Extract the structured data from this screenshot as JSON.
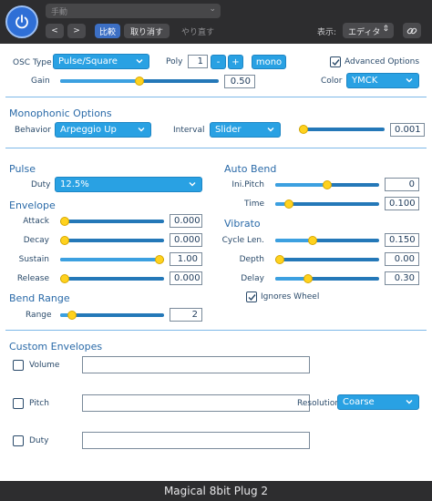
{
  "host": {
    "preset_name": "手動",
    "prev_label": "<",
    "next_label": ">",
    "compare_label": "比較",
    "undo_label": "取り消す",
    "redo_label": "やり直す",
    "view_label": "表示:",
    "view_value": "エディタ"
  },
  "osc": {
    "type_label": "OSC Type",
    "type_value": "Pulse/Square",
    "poly_label": "Poly",
    "poly_value": "1",
    "minus_label": "-",
    "plus_label": "+",
    "mono_label": "mono",
    "advanced_label": "Advanced Options",
    "advanced_checked": true,
    "gain_label": "Gain",
    "gain_value": "0.50",
    "gain_fraction": 0.5,
    "color_label": "Color",
    "color_value": "YMCK"
  },
  "mono": {
    "title": "Monophonic Options",
    "behavior_label": "Behavior",
    "behavior_value": "Arpeggio Up",
    "interval_label": "Interval",
    "interval_value": "Slider",
    "interval_num": "0.001",
    "interval_fraction": 0.0
  },
  "pulse": {
    "title": "Pulse",
    "duty_label": "Duty",
    "duty_value": "12.5%"
  },
  "envelope": {
    "title": "Envelope",
    "rows": [
      {
        "label": "Attack",
        "value": "0.000",
        "fraction": 0.0
      },
      {
        "label": "Decay",
        "value": "0.000",
        "fraction": 0.0
      },
      {
        "label": "Sustain",
        "value": "1.00",
        "fraction": 1.0
      },
      {
        "label": "Release",
        "value": "0.000",
        "fraction": 0.0
      }
    ]
  },
  "bend_range": {
    "title": "Bend Range",
    "range_label": "Range",
    "range_value": "2",
    "range_fraction": 0.08
  },
  "auto_bend": {
    "title": "Auto Bend",
    "rows": [
      {
        "label": "Ini.Pitch",
        "value": "0",
        "fraction": 0.5
      },
      {
        "label": "Time",
        "value": "0.100",
        "fraction": 0.1
      }
    ]
  },
  "vibrato": {
    "title": "Vibrato",
    "rows": [
      {
        "label": "Cycle Len.",
        "value": "0.150",
        "fraction": 0.35
      },
      {
        "label": "Depth",
        "value": "0.00",
        "fraction": 0.0
      },
      {
        "label": "Delay",
        "value": "0.30",
        "fraction": 0.3
      }
    ],
    "ignores_wheel_label": "Ignores Wheel",
    "ignores_wheel_checked": true
  },
  "custom": {
    "title": "Custom Envelopes",
    "volume_label": "Volume",
    "pitch_label": "Pitch",
    "duty_label": "Duty",
    "resolution_label": "Resolution",
    "resolution_value": "Coarse"
  },
  "footer": {
    "title": "Magical 8bit Plug 2"
  },
  "colors": {
    "accent": "#29a1e3",
    "thumb": "#ffd21e",
    "section": "#2a6aa8"
  }
}
